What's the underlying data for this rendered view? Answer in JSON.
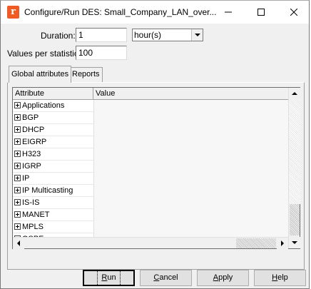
{
  "window": {
    "title": "Configure/Run DES: Small_Company_LAN_over...",
    "app_icon_glyph": "r",
    "icons": [
      "minimize-icon",
      "maximize-icon",
      "close-icon"
    ]
  },
  "form": {
    "duration_label": "Duration:",
    "duration_value": "1",
    "duration_unit": "hour(s)",
    "values_label": "Values per statistic:",
    "values_value": "100"
  },
  "tabs": [
    {
      "label": "Global attributes",
      "active": true
    },
    {
      "label": "Reports",
      "active": false
    }
  ],
  "grid": {
    "columns": [
      "Attribute",
      "Value"
    ],
    "rows": [
      {
        "attribute": "Applications",
        "value": ""
      },
      {
        "attribute": "BGP",
        "value": ""
      },
      {
        "attribute": "DHCP",
        "value": ""
      },
      {
        "attribute": "EIGRP",
        "value": ""
      },
      {
        "attribute": "H323",
        "value": ""
      },
      {
        "attribute": "IGRP",
        "value": ""
      },
      {
        "attribute": "IP",
        "value": ""
      },
      {
        "attribute": "IP Multicasting",
        "value": ""
      },
      {
        "attribute": "IS-IS",
        "value": ""
      },
      {
        "attribute": "MANET",
        "value": ""
      },
      {
        "attribute": "MPLS",
        "value": ""
      },
      {
        "attribute": "OSPF",
        "value": ""
      }
    ]
  },
  "buttons": {
    "run": {
      "label": "Run",
      "underline_index": 0
    },
    "cancel": {
      "label": "Cancel",
      "underline_index": 0
    },
    "apply": {
      "label": "Apply",
      "underline_index": 0
    },
    "help": {
      "label": "Help",
      "underline_index": 0
    }
  },
  "colors": {
    "app_icon": "#f05a24",
    "dialog_bg": "#f0f0f0"
  }
}
